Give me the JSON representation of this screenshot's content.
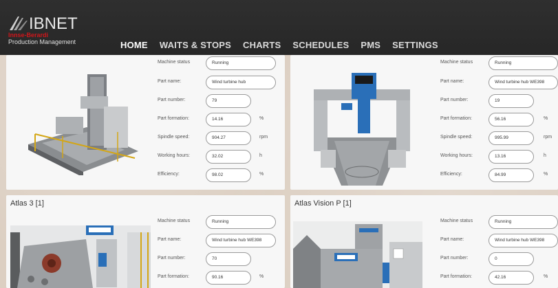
{
  "header": {
    "brand": "IBNET",
    "brand_sub1": "Innse-Berardi",
    "brand_sub2": "Production Management",
    "nav": [
      "HOME",
      "WAITS & STOPS",
      "CHARTS",
      "SCHEDULES",
      "PMS",
      "SETTINGS"
    ],
    "active_nav": "HOME"
  },
  "labels": {
    "machine_status": "Machine status",
    "part_name": "Part name:",
    "part_number": "Part number:",
    "part_formation": "Part formation:",
    "spindle_speed": "Spindle speed:",
    "working_hours": "Working hours:",
    "efficiency": "Efficiency:"
  },
  "units": {
    "percent": "%",
    "rpm": "rpm",
    "hours": "h"
  },
  "machines": [
    {
      "title": "",
      "status": "Running",
      "part_name": "Wind turbine hub",
      "part_number": "79",
      "part_formation": "14.16",
      "spindle_speed": "904.27",
      "working_hours": "32.02",
      "efficiency": "98.02"
    },
    {
      "title": "",
      "status": "Running",
      "part_name": "Wind turbine hub WE398",
      "part_number": "19",
      "part_formation": "56.16",
      "spindle_speed": "995.99",
      "working_hours": "13.16",
      "efficiency": "84.99"
    },
    {
      "title": "Atlas 3 [1]",
      "status": "Running",
      "part_name": "Wind turbine hub WE398",
      "part_number": "70",
      "part_formation": "90.16"
    },
    {
      "title": "Atlas Vision P [1]",
      "status": "Running",
      "part_name": "Wind turbine hub WE398",
      "part_number": "0",
      "part_formation": "42.16"
    }
  ]
}
